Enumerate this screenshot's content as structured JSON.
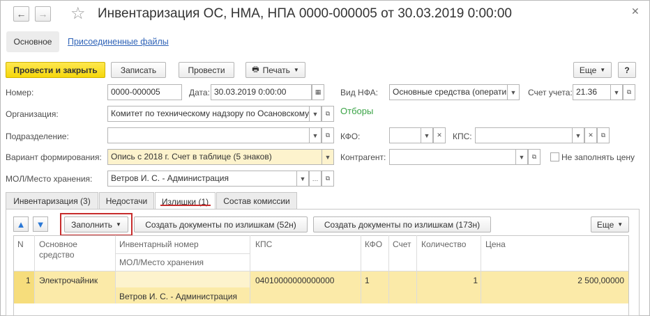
{
  "title": "Инвентаризация ОС, НМА, НПА 0000-000005 от 30.03.2019 0:00:00",
  "nav": {
    "back": "←",
    "forward": "→",
    "star": "☆",
    "close": "✕"
  },
  "tabs_top": {
    "main": "Основное",
    "files": "Присоединенные файлы"
  },
  "toolbar": {
    "post_close": "Провести и закрыть",
    "save": "Записать",
    "post": "Провести",
    "print": "Печать",
    "more": "Еще",
    "help": "?"
  },
  "form": {
    "number_label": "Номер:",
    "number_value": "0000-000005",
    "date_label": "Дата:",
    "date_value": "30.03.2019  0:00:00",
    "nfa_label": "Вид НФА:",
    "nfa_value": "Основные средства (операти",
    "account_label": "Счет учета:",
    "account_value": "21.36",
    "org_label": "Организация:",
    "org_value": "Комитет по техническому надзору по Осановскому",
    "filters": "Отборы",
    "dept_label": "Подразделение:",
    "dept_value": "",
    "kfo_label": "КФО:",
    "kfo_value": "",
    "kps_label": "КПС:",
    "kps_value": "",
    "variant_label": "Вариант формирования:",
    "variant_value": "Опись с 2018 г. Счет в таблице (5 знаков)",
    "contractor_label": "Контрагент:",
    "contractor_value": "",
    "no_price_label": "Не заполнять цену",
    "mol_label": "МОЛ/Место хранения:",
    "mol_value": "Ветров И. С. - Администрация"
  },
  "tabs": [
    "Инвентаризация (3)",
    "Недостачи",
    "Излишки (1)",
    "Состав комиссии"
  ],
  "tab_toolbar": {
    "fill": "Заполнить",
    "create52": "Создать документы по излишкам (52н)",
    "create173": "Создать документы по излишкам (173н)",
    "more": "Еще"
  },
  "table": {
    "headers": {
      "n": "N",
      "asset": "Основное средство",
      "inv": "Инвентарный номер",
      "mol": "МОЛ/Место хранения",
      "kps": "КПС",
      "kfo": "КФО",
      "account": "Счет",
      "qty": "Количество",
      "price": "Цена"
    },
    "rows": [
      {
        "n": "1",
        "asset": "Электрочайник",
        "inv": "",
        "mol": "Ветров И. С. - Администрация",
        "kps": "04010000000000000",
        "kfo": "1",
        "account": "",
        "qty": "1",
        "price": "2 500,00000"
      }
    ]
  },
  "colors": {
    "accent_yellow": "#f5d70b",
    "link": "#2f63b7",
    "filter_green": "#3aa346",
    "highlight_red": "#c72c2c",
    "row_yellow": "#fbeaa8"
  }
}
